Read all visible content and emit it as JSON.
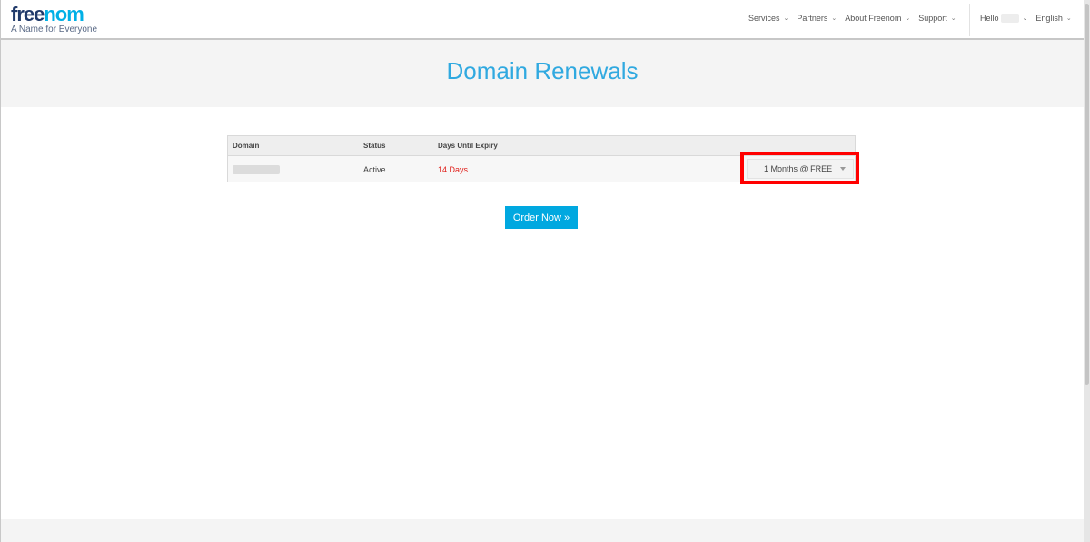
{
  "brand": {
    "logo_free": "free",
    "logo_nom": "nom",
    "tagline": "A Name for Everyone",
    "accent_color": "#00b0e6"
  },
  "nav": {
    "items": [
      "Services",
      "Partners",
      "About Freenom",
      "Support"
    ],
    "hello": "Hello",
    "language": "English",
    "chevron_icon": "chevron-down-icon"
  },
  "page": {
    "title": "Domain Renewals"
  },
  "table": {
    "headers": [
      "Domain",
      "Status",
      "Days Until Expiry"
    ],
    "rows": [
      {
        "status": "Active",
        "expiry": "14 Days",
        "period": "1 Months @ FREE"
      }
    ]
  },
  "actions": {
    "order_label": "Order Now »"
  }
}
